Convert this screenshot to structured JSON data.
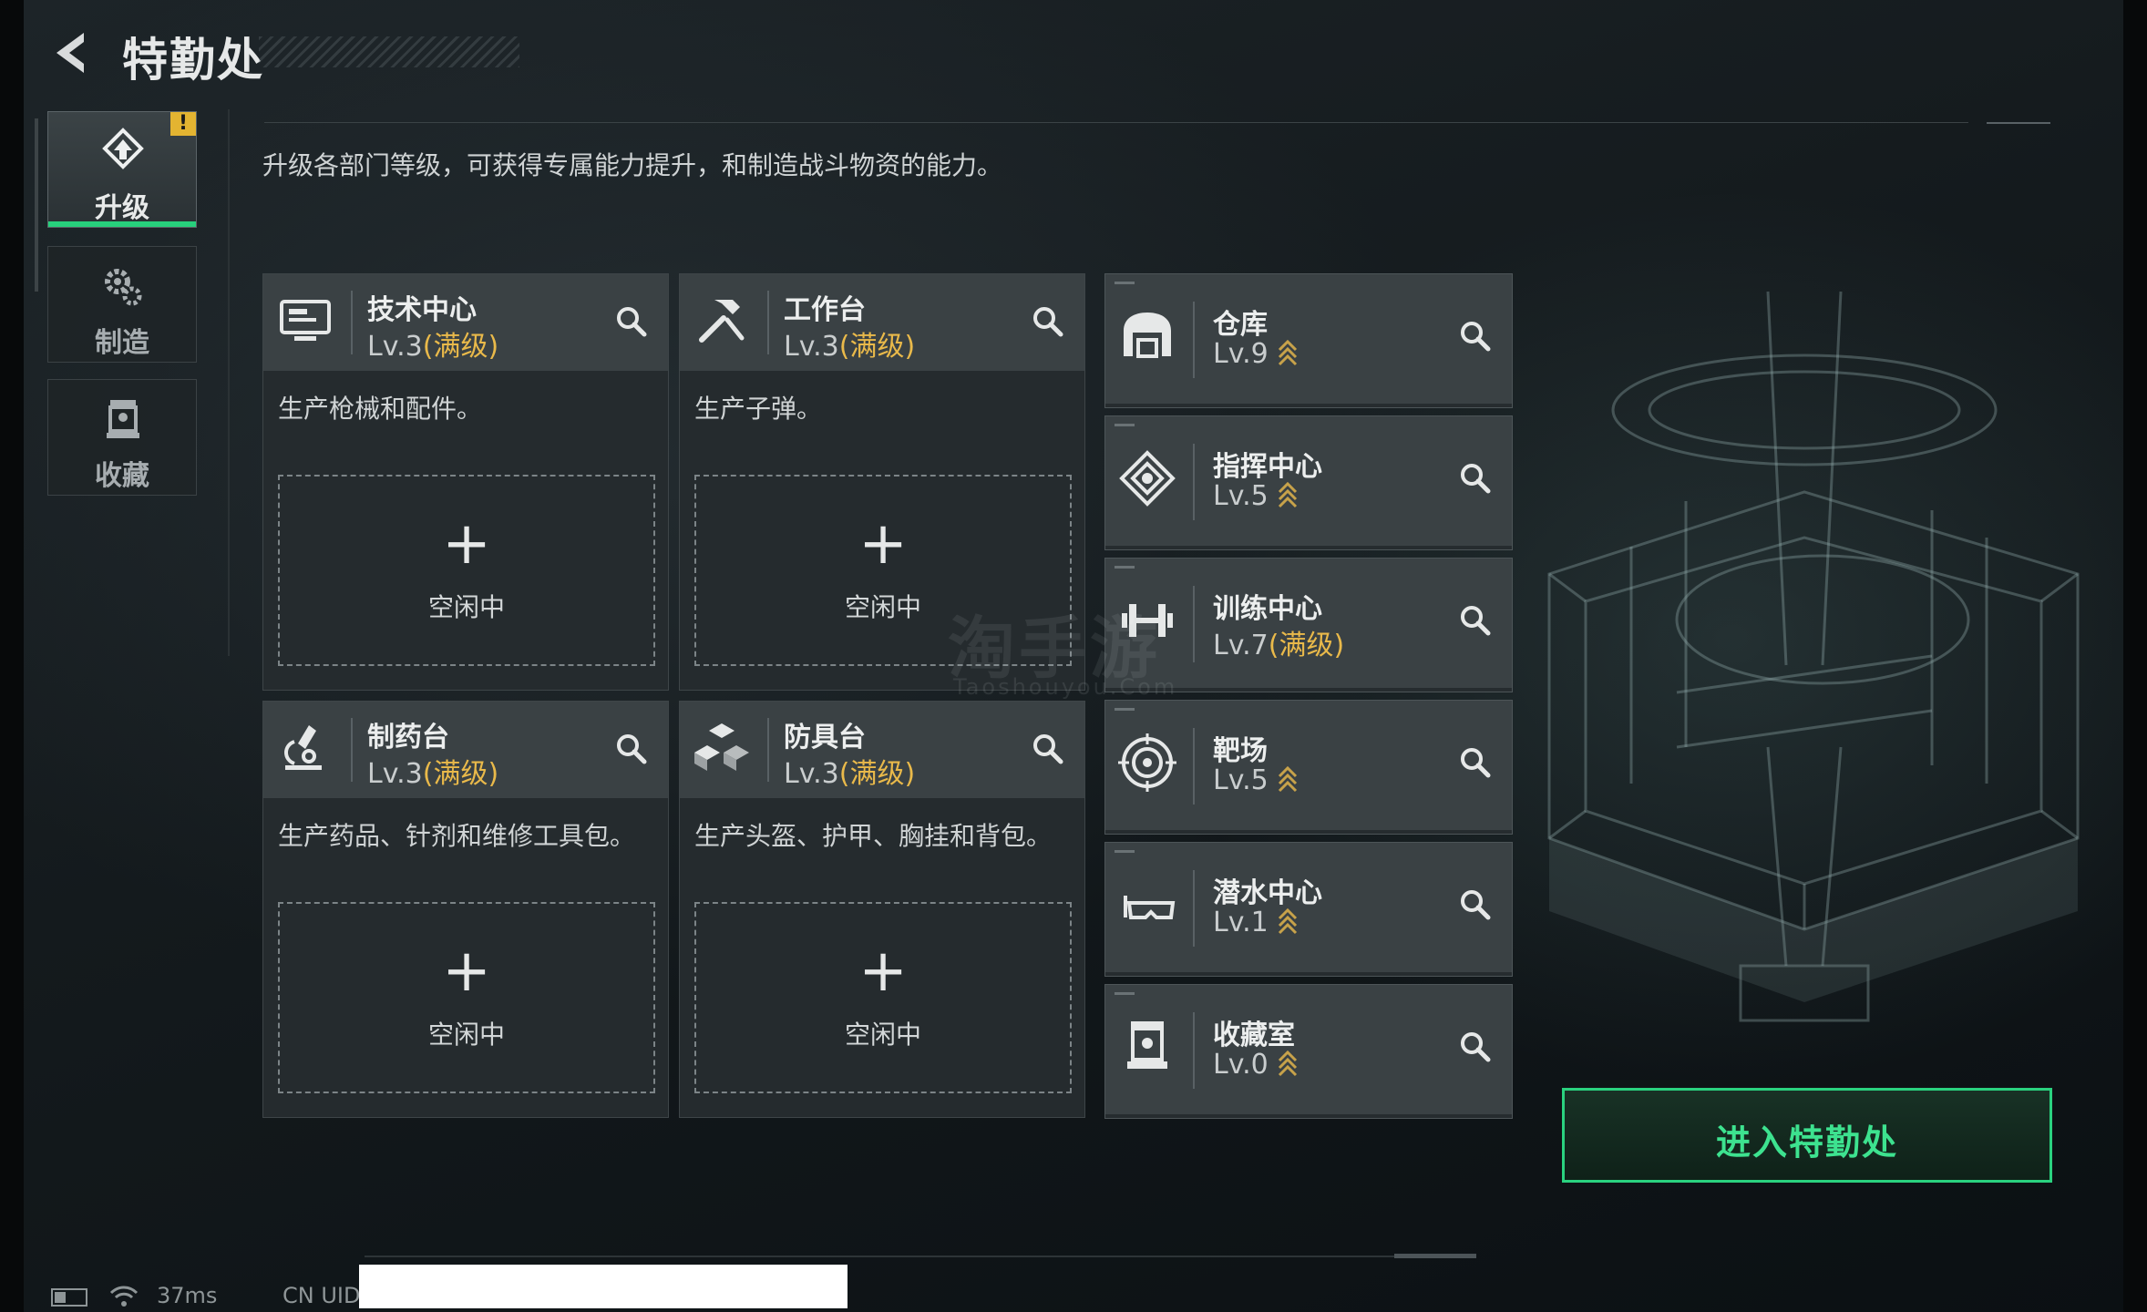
{
  "header": {
    "title": "特勤处",
    "back_icon": "back-arrow-icon"
  },
  "sidebar": {
    "tabs": [
      {
        "label": "升级",
        "icon": "upgrade-icon",
        "active": true,
        "badge": "!"
      },
      {
        "label": "制造",
        "icon": "gears-icon",
        "active": false
      },
      {
        "label": "收藏",
        "icon": "collection-icon",
        "active": false
      }
    ]
  },
  "description": "升级各部门等级，可获得专属能力提升，和制造战斗物资的能力。",
  "departments": [
    {
      "name": "技术中心",
      "level": "Lv.3",
      "max": "(满级)",
      "icon": "computer-icon",
      "desc": "生产枪械和配件。",
      "slot_plus": "+",
      "slot_text": "空闲中"
    },
    {
      "name": "工作台",
      "level": "Lv.3",
      "max": "(满级)",
      "icon": "tools-icon",
      "desc": "生产子弹。",
      "slot_plus": "+",
      "slot_text": "空闲中"
    },
    {
      "name": "制药台",
      "level": "Lv.3",
      "max": "(满级)",
      "icon": "microscope-icon",
      "desc": "生产药品、针剂和维修工具包。",
      "slot_plus": "+",
      "slot_text": "空闲中"
    },
    {
      "name": "防具台",
      "level": "Lv.3",
      "max": "(满级)",
      "icon": "armor-blocks-icon",
      "desc": "生产头盔、护甲、胸挂和背包。",
      "slot_plus": "+",
      "slot_text": "空闲中"
    }
  ],
  "facilities": [
    {
      "name": "仓库",
      "level": "Lv.9",
      "max": "",
      "upgradable": true,
      "icon": "warehouse-icon"
    },
    {
      "name": "指挥中心",
      "level": "Lv.5",
      "max": "",
      "upgradable": true,
      "icon": "command-chip-icon"
    },
    {
      "name": "训练中心",
      "level": "Lv.7",
      "max": "(满级)",
      "upgradable": false,
      "icon": "dumbbell-icon"
    },
    {
      "name": "靶场",
      "level": "Lv.5",
      "max": "",
      "upgradable": true,
      "icon": "target-icon"
    },
    {
      "name": "潜水中心",
      "level": "Lv.1",
      "max": "",
      "upgradable": true,
      "icon": "diving-mask-icon"
    },
    {
      "name": "收藏室",
      "level": "Lv.0",
      "max": "",
      "upgradable": true,
      "icon": "display-case-icon"
    }
  ],
  "enter_button": "进入特勤处",
  "status_bar": {
    "ping": "37ms",
    "uid_label": "CN UID"
  },
  "watermark": {
    "main": "淘手游",
    "sub": "Taoshouyou.Com"
  },
  "colors": {
    "accent_green": "#2ad27f",
    "max_level": "#e9b94a",
    "warning": "#e3b431"
  }
}
